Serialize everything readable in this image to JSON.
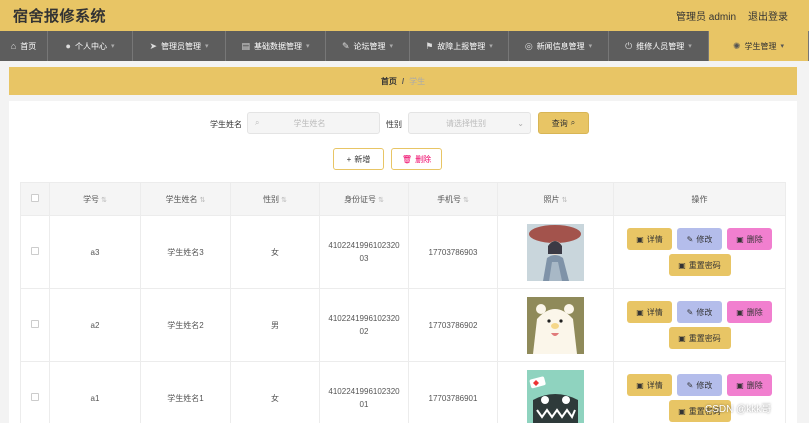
{
  "header": {
    "title": "宿舍报修系统",
    "admin_text": "管理员 admin",
    "logout": "退出登录"
  },
  "nav": {
    "items": [
      {
        "label": "首页",
        "icon": "home-icon",
        "has_chevron": false
      },
      {
        "label": "个人中心",
        "icon": "user-icon",
        "has_chevron": true
      },
      {
        "label": "管理员管理",
        "icon": "send-icon",
        "has_chevron": true
      },
      {
        "label": "基础数据管理",
        "icon": "database-icon",
        "has_chevron": true
      },
      {
        "label": "论坛管理",
        "icon": "forum-icon",
        "has_chevron": true
      },
      {
        "label": "故障上报管理",
        "icon": "report-icon",
        "has_chevron": true
      },
      {
        "label": "新闻信息管理",
        "icon": "news-icon",
        "has_chevron": true
      },
      {
        "label": "维修人员管理",
        "icon": "power-icon",
        "has_chevron": true
      },
      {
        "label": "学生管理",
        "icon": "student-icon",
        "has_chevron": true
      }
    ]
  },
  "breadcrumb": {
    "home": "首页",
    "separator": "/",
    "current": "学生"
  },
  "search": {
    "name_label": "学生姓名",
    "name_placeholder": "学生姓名",
    "gender_label": "性别",
    "gender_placeholder": "请选择性别",
    "query_label": "查询"
  },
  "actions": {
    "add_label": "新增",
    "delete_label": "删除"
  },
  "table": {
    "headers": [
      "学号",
      "学生姓名",
      "性别",
      "身份证号",
      "手机号",
      "照片",
      "操作"
    ],
    "rows": [
      {
        "id": "a3",
        "name": "学生姓名3",
        "gender": "女",
        "id_card_line1": "4102241996102320",
        "id_card_line2": "03",
        "phone": "17703786903",
        "photo": "girl-portrait"
      },
      {
        "id": "a2",
        "name": "学生姓名2",
        "gender": "男",
        "id_card_line1": "4102241996102320",
        "id_card_line2": "02",
        "phone": "17703786902",
        "photo": "bear-illustration"
      },
      {
        "id": "a1",
        "name": "学生姓名1",
        "gender": "女",
        "id_card_line1": "4102241996102320",
        "id_card_line2": "01",
        "phone": "17703786901",
        "photo": "monster-illustration"
      }
    ],
    "op_labels": {
      "detail": "详情",
      "edit": "修改",
      "remove": "删除",
      "reset": "重置密码"
    }
  },
  "watermark": "CSDN @kkk哥",
  "colors": {
    "accent": "#e8c565",
    "nav_bg": "#5d5d5d",
    "edit": "#b4bdeb",
    "remove": "#f17fcf"
  }
}
